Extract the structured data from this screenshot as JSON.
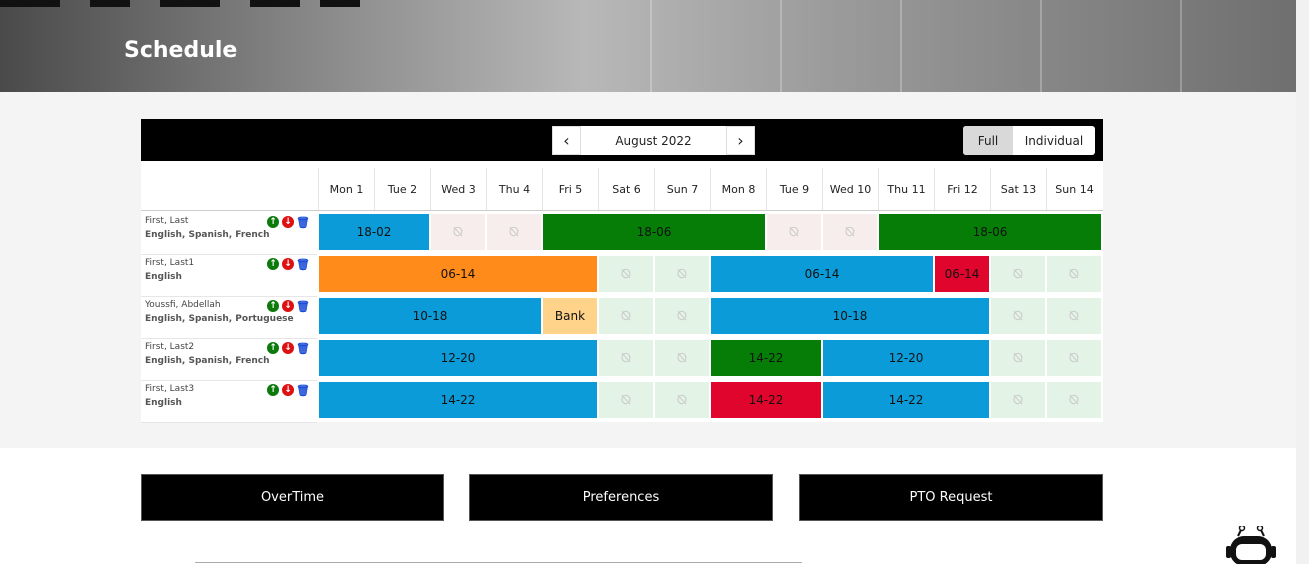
{
  "page": {
    "title": "Schedule"
  },
  "toolbar": {
    "month": "August 2022",
    "prev_icon": "chevron-left-icon",
    "next_icon": "chevron-right-icon",
    "views": [
      "Full",
      "Individual"
    ],
    "selected_view": "Full"
  },
  "days": [
    "Mon 1",
    "Tue 2",
    "Wed 3",
    "Thu 4",
    "Fri 5",
    "Sat 6",
    "Sun 7",
    "Mon 8",
    "Tue 9",
    "Wed 10",
    "Thu 11",
    "Fri 12",
    "Sat 13",
    "Sun 14"
  ],
  "colors": {
    "blue": "#0b9bd9",
    "green": "#067d06",
    "orange": "#ff8c1a",
    "red": "#e0052c",
    "bank": "#ffd38a",
    "off_pink": "#f8eded",
    "off_green": "#e3f3e6"
  },
  "employees": [
    {
      "name": "First, Last",
      "languages": "English, Spanish, French",
      "shifts": [
        {
          "start": 0,
          "span": 2,
          "label": "18-02",
          "color": "blue"
        },
        {
          "start": 2,
          "span": 1,
          "off": "pink"
        },
        {
          "start": 3,
          "span": 1,
          "off": "pink"
        },
        {
          "start": 4,
          "span": 4,
          "label": "18-06",
          "color": "green"
        },
        {
          "start": 8,
          "span": 1,
          "off": "pink"
        },
        {
          "start": 9,
          "span": 1,
          "off": "pink"
        },
        {
          "start": 10,
          "span": 4,
          "label": "18-06",
          "color": "green"
        }
      ]
    },
    {
      "name": "First, Last1",
      "languages": "English",
      "shifts": [
        {
          "start": 0,
          "span": 5,
          "label": "06-14",
          "color": "orange"
        },
        {
          "start": 5,
          "span": 1,
          "off": "green"
        },
        {
          "start": 6,
          "span": 1,
          "off": "green"
        },
        {
          "start": 7,
          "span": 4,
          "label": "06-14",
          "color": "blue"
        },
        {
          "start": 11,
          "span": 1,
          "label": "06-14",
          "color": "red"
        },
        {
          "start": 12,
          "span": 1,
          "off": "green"
        },
        {
          "start": 13,
          "span": 1,
          "off": "green"
        }
      ]
    },
    {
      "name": "Youssfi, Abdellah",
      "languages": "English, Spanish, Portuguese",
      "shifts": [
        {
          "start": 0,
          "span": 4,
          "label": "10-18",
          "color": "blue"
        },
        {
          "start": 4,
          "span": 1,
          "label": "Bank",
          "color": "bank"
        },
        {
          "start": 5,
          "span": 1,
          "off": "green"
        },
        {
          "start": 6,
          "span": 1,
          "off": "green"
        },
        {
          "start": 7,
          "span": 5,
          "label": "10-18",
          "color": "blue"
        },
        {
          "start": 12,
          "span": 1,
          "off": "green"
        },
        {
          "start": 13,
          "span": 1,
          "off": "green"
        }
      ]
    },
    {
      "name": "First, Last2",
      "languages": "English, Spanish, French",
      "shifts": [
        {
          "start": 0,
          "span": 5,
          "label": "12-20",
          "color": "blue"
        },
        {
          "start": 5,
          "span": 1,
          "off": "green"
        },
        {
          "start": 6,
          "span": 1,
          "off": "green"
        },
        {
          "start": 7,
          "span": 2,
          "label": "14-22",
          "color": "green"
        },
        {
          "start": 9,
          "span": 3,
          "label": "12-20",
          "color": "blue"
        },
        {
          "start": 12,
          "span": 1,
          "off": "green"
        },
        {
          "start": 13,
          "span": 1,
          "off": "green"
        }
      ]
    },
    {
      "name": "First, Last3",
      "languages": "English",
      "shifts": [
        {
          "start": 0,
          "span": 5,
          "label": "14-22",
          "color": "blue"
        },
        {
          "start": 5,
          "span": 1,
          "off": "green"
        },
        {
          "start": 6,
          "span": 1,
          "off": "green"
        },
        {
          "start": 7,
          "span": 2,
          "label": "14-22",
          "color": "red"
        },
        {
          "start": 9,
          "span": 3,
          "label": "14-22",
          "color": "blue"
        },
        {
          "start": 12,
          "span": 1,
          "off": "green"
        },
        {
          "start": 13,
          "span": 1,
          "off": "green"
        }
      ]
    }
  ],
  "actions": [
    "OverTime",
    "Preferences",
    "PTO Request"
  ]
}
